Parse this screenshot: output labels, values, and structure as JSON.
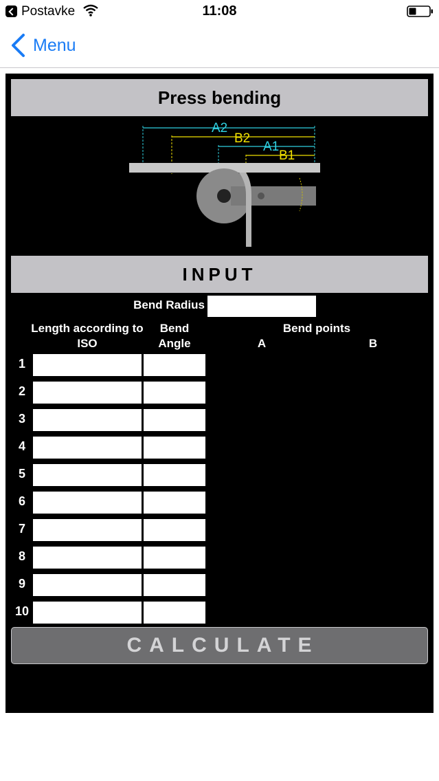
{
  "status_bar": {
    "back_app": "Postavke",
    "time": "11:08"
  },
  "nav": {
    "back_label": "Menu"
  },
  "panel": {
    "title": "Press bending",
    "input_header": "INPUT",
    "diagram": {
      "labels": [
        "A2",
        "B2",
        "A1",
        "B1"
      ]
    },
    "bend_radius_label": "Bend Radius",
    "columns": {
      "length": "Length according to ISO",
      "angle": "Bend Angle",
      "bend_points": "Bend points",
      "point_a": "A",
      "point_b": "B"
    },
    "rows": [
      {
        "n": "1"
      },
      {
        "n": "2"
      },
      {
        "n": "3"
      },
      {
        "n": "4"
      },
      {
        "n": "5"
      },
      {
        "n": "6"
      },
      {
        "n": "7"
      },
      {
        "n": "8"
      },
      {
        "n": "9"
      },
      {
        "n": "10"
      }
    ],
    "calculate_label": "CALCULATE"
  },
  "colors": {
    "accent_blue": "#1a7cf5",
    "header_gray": "#c3c2c6",
    "button_gray": "#6e6e70",
    "diagram_cyan": "#2fd0e0",
    "diagram_yellow": "#f0e000"
  }
}
